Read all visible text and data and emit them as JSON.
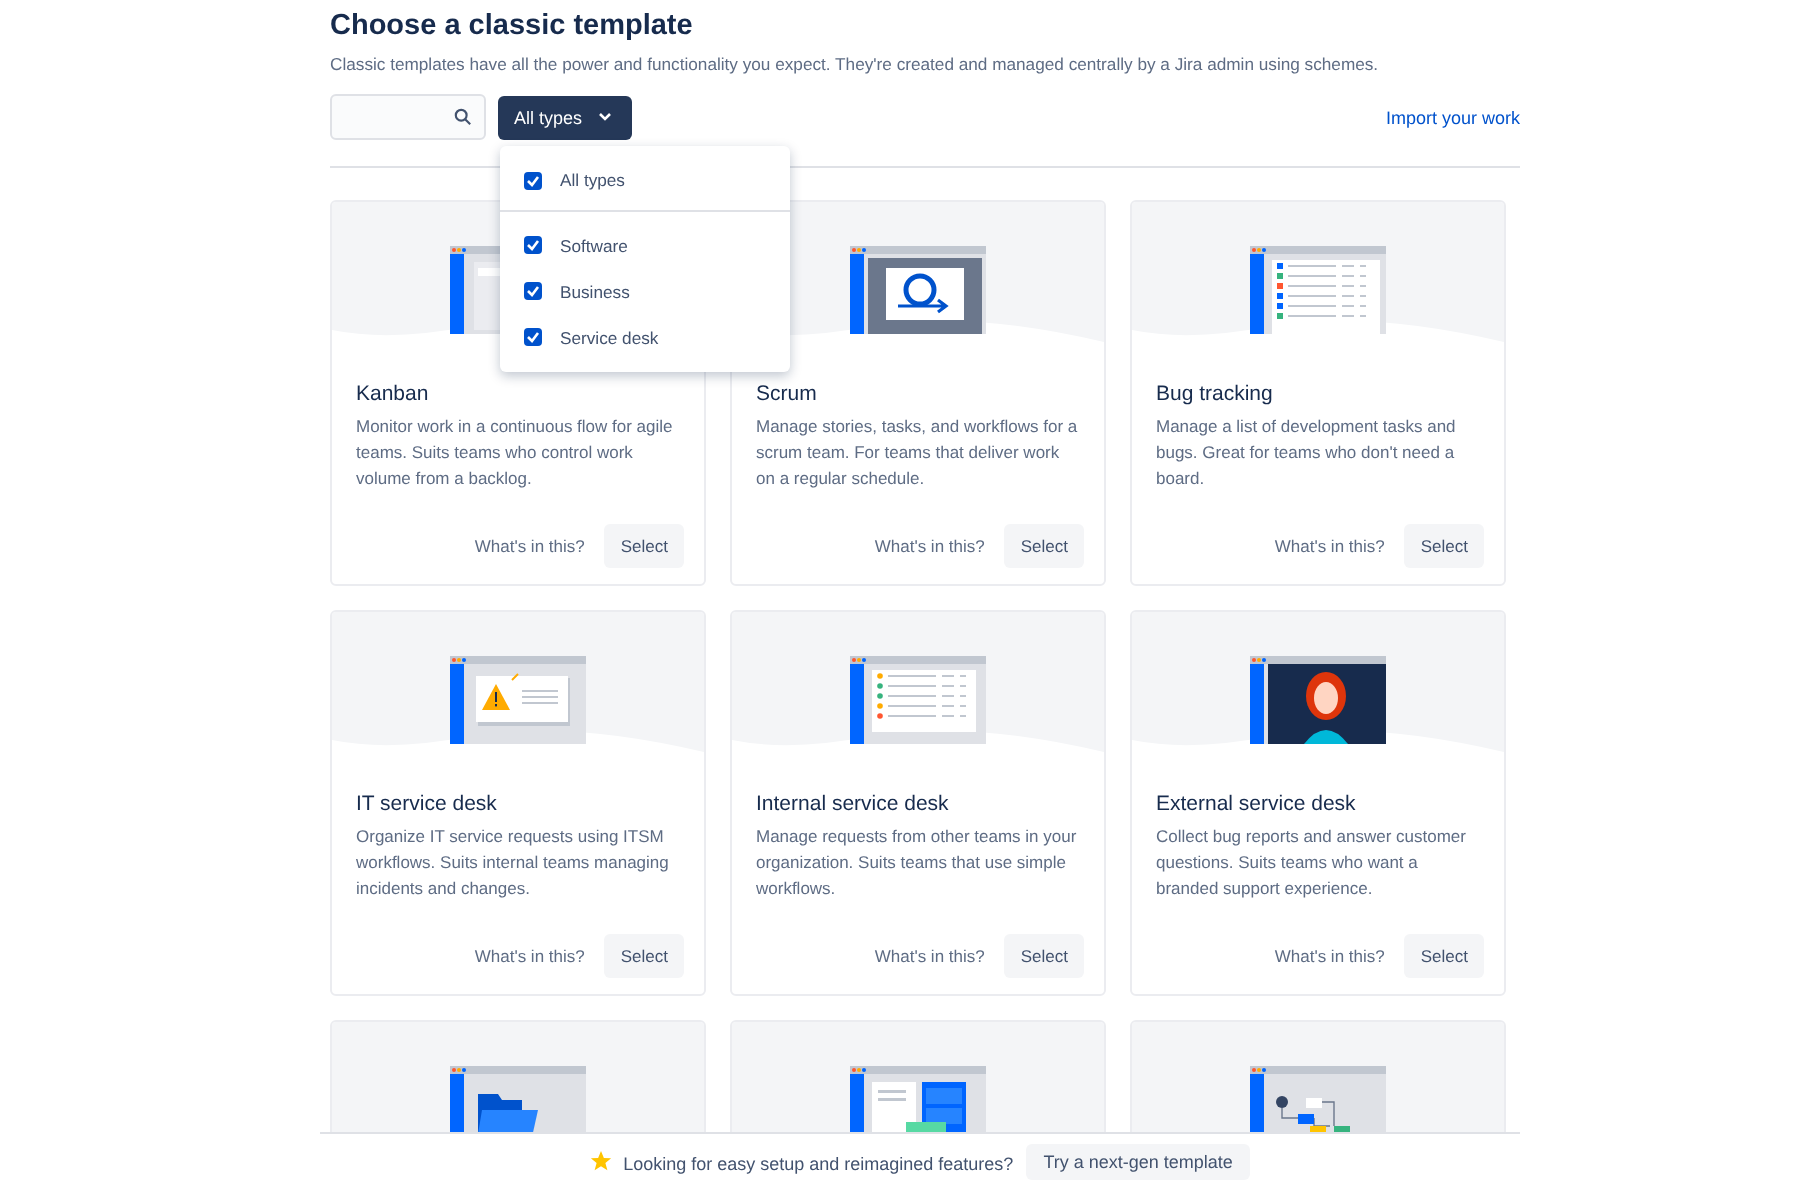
{
  "heading": "Choose a classic template",
  "subtitle": "Classic templates have all the power and functionality you expect. They're created and managed centrally by a Jira admin using schemes.",
  "type_filter": {
    "label": "All types",
    "expanded": true,
    "options": [
      {
        "label": "All types",
        "checked": true
      },
      {
        "label": "Software",
        "checked": true
      },
      {
        "label": "Business",
        "checked": true
      },
      {
        "label": "Service desk",
        "checked": true
      }
    ]
  },
  "import_link": "Import your work",
  "templates": [
    {
      "kind": "board",
      "title": "Kanban",
      "description": "Monitor work in a continuous flow for agile teams. Suits teams who control work volume from a backlog.",
      "info": "What's in this?",
      "action": "Select"
    },
    {
      "kind": "loop",
      "title": "Scrum",
      "description": "Manage stories, tasks, and workflows for a scrum team. For teams that deliver work on a regular schedule.",
      "info": "What's in this?",
      "action": "Select"
    },
    {
      "kind": "list",
      "title": "Bug tracking",
      "description": "Manage a list of development tasks and bugs. Great for teams who don't need a board.",
      "info": "What's in this?",
      "action": "Select"
    },
    {
      "kind": "warning",
      "title": "IT service desk",
      "description": "Organize IT service requests using ITSM workflows. Suits internal teams managing incidents and changes.",
      "info": "What's in this?",
      "action": "Select"
    },
    {
      "kind": "dots",
      "title": "Internal service desk",
      "description": "Manage requests from other teams in your organization. Suits teams that use simple workflows.",
      "info": "What's in this?",
      "action": "Select"
    },
    {
      "kind": "person",
      "title": "External service desk",
      "description": "Collect bug reports and answer customer questions. Suits teams who want a branded support experience.",
      "info": "What's in this?",
      "action": "Select"
    },
    {
      "kind": "folder"
    },
    {
      "kind": "docs"
    },
    {
      "kind": "flow"
    }
  ],
  "footer": {
    "message": "Looking for easy setup and reimagined features?",
    "button": "Try a next-gen template"
  }
}
